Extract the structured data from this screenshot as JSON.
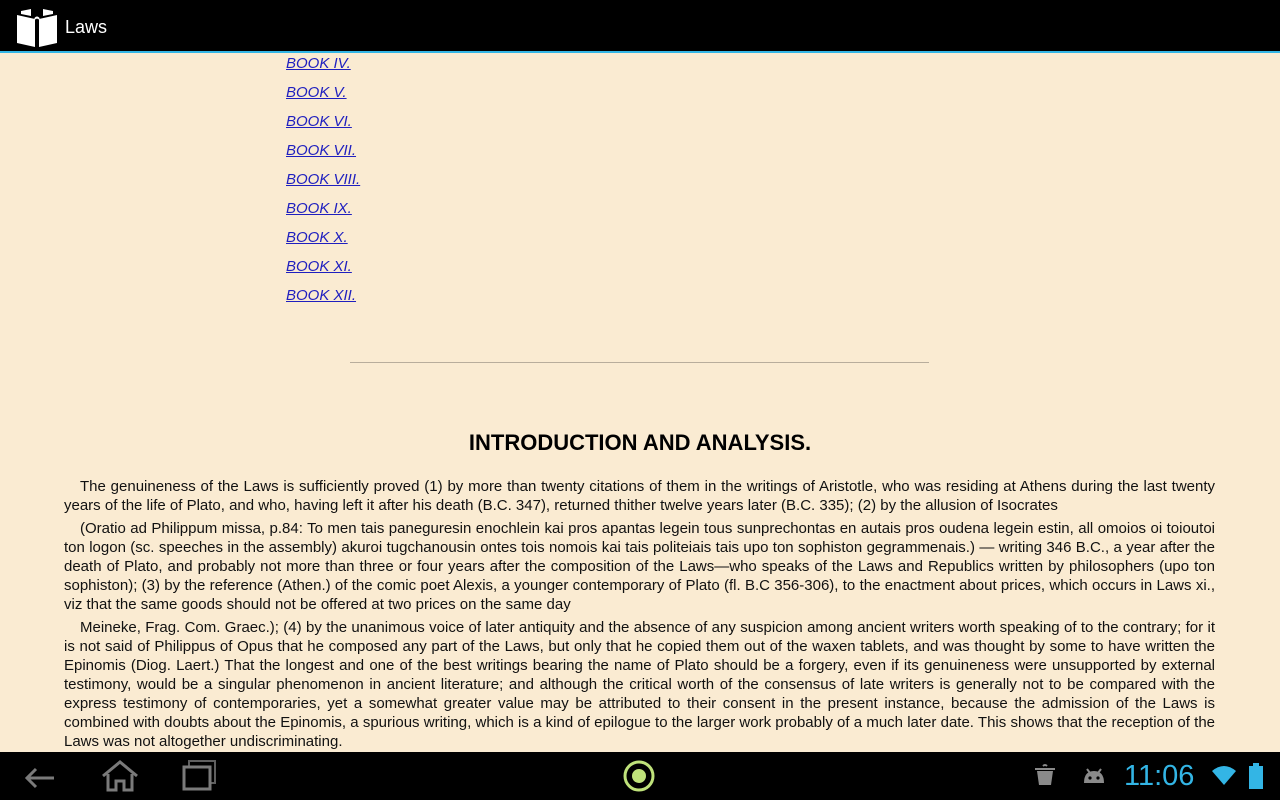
{
  "app": {
    "title": "Laws"
  },
  "toc": {
    "items": [
      "BOOK IV.",
      "BOOK V.",
      "BOOK VI.",
      "BOOK VII.",
      "BOOK VIII.",
      "BOOK IX.",
      "BOOK X.",
      "BOOK XI.",
      "BOOK XII."
    ]
  },
  "section": {
    "heading": "INTRODUCTION AND ANALYSIS.",
    "paragraphs": [
      "The genuineness of the Laws is sufficiently proved (1) by more than twenty citations of them in the writings of Aristotle, who was residing at Athens during the last twenty years of the life of Plato, and who, having left it after his death (B.C. 347), returned thither twelve years later (B.C. 335); (2) by the allusion of Isocrates",
      "(Oratio ad Philippum missa, p.84: To men tais paneguresin enochlein kai pros apantas legein tous sunprechontas en autais pros oudena legein estin, all omoios oi toioutoi ton logon (sc. speeches in the assembly) akuroi tugchanousin ontes tois nomois kai tais politeiais tais upo ton sophiston gegrammenais.) — writing 346 B.C., a year after the death of Plato, and probably not more than three or four years after the composition of the Laws—who speaks of the Laws and Republics written by philosophers (upo ton sophiston); (3) by the reference (Athen.) of the comic poet Alexis, a younger contemporary of Plato (fl. B.C 356-306), to the enactment about prices, which occurs in Laws xi., viz that the same goods should not be offered at two prices on the same day",
      "Meineke, Frag. Com. Graec.); (4) by the unanimous voice of later antiquity and the absence of any suspicion among ancient writers worth speaking of to the contrary; for it is not said of Philippus of Opus that he composed any part of the Laws, but only that he copied them out of the waxen tablets, and was thought by some to have written the Epinomis (Diog. Laert.) That the longest and one of the best writings bearing the name of Plato should be a forgery, even if its genuineness were unsupported by external testimony, would be a singular phenomenon in ancient literature; and although the critical worth of the consensus of late writers is generally not to be compared with the express testimony of contemporaries, yet a somewhat greater value may be attributed to their consent in the present instance, because the admission of the Laws is combined with doubts about the Epinomis, a spurious writing, which is a kind of epilogue to the larger work probably of a much later date. This shows that the reception of the Laws was not altogether undiscriminating."
    ]
  },
  "system": {
    "clock": "11:06",
    "accent_color": "#33b5e5",
    "background_color": "#faebd2",
    "link_color": "#1f1fbf",
    "icons": [
      "back-icon",
      "home-icon",
      "recent-apps-icon",
      "launcher-icon",
      "coffee-cup-icon",
      "android-debug-icon",
      "wifi-icon",
      "battery-icon"
    ]
  }
}
